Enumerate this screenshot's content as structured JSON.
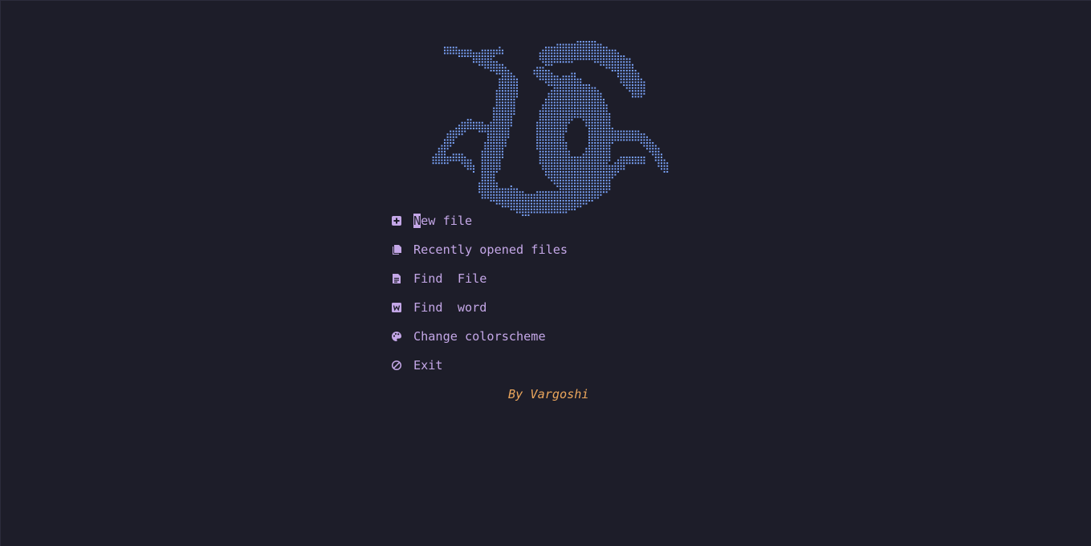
{
  "colors": {
    "background": "#1d1d29",
    "logo": "#7aa2f7",
    "menu": "#c4a7e7",
    "footer": "#eba65c"
  },
  "logo": {
    "icon": "dragon-ascii-logo"
  },
  "menu": {
    "items": [
      {
        "icon": "plus-square-icon",
        "label": "New file",
        "cursor_char": "N",
        "label_rest": "ew file"
      },
      {
        "icon": "files-icon",
        "label": "Recently opened files"
      },
      {
        "icon": "file-text-icon",
        "label": "Find  File"
      },
      {
        "icon": "word-icon",
        "label": "Find  word"
      },
      {
        "icon": "palette-icon",
        "label": "Change colorscheme"
      },
      {
        "icon": "exit-icon",
        "label": "Exit"
      }
    ]
  },
  "footer": {
    "text": "By Vargoshi"
  }
}
